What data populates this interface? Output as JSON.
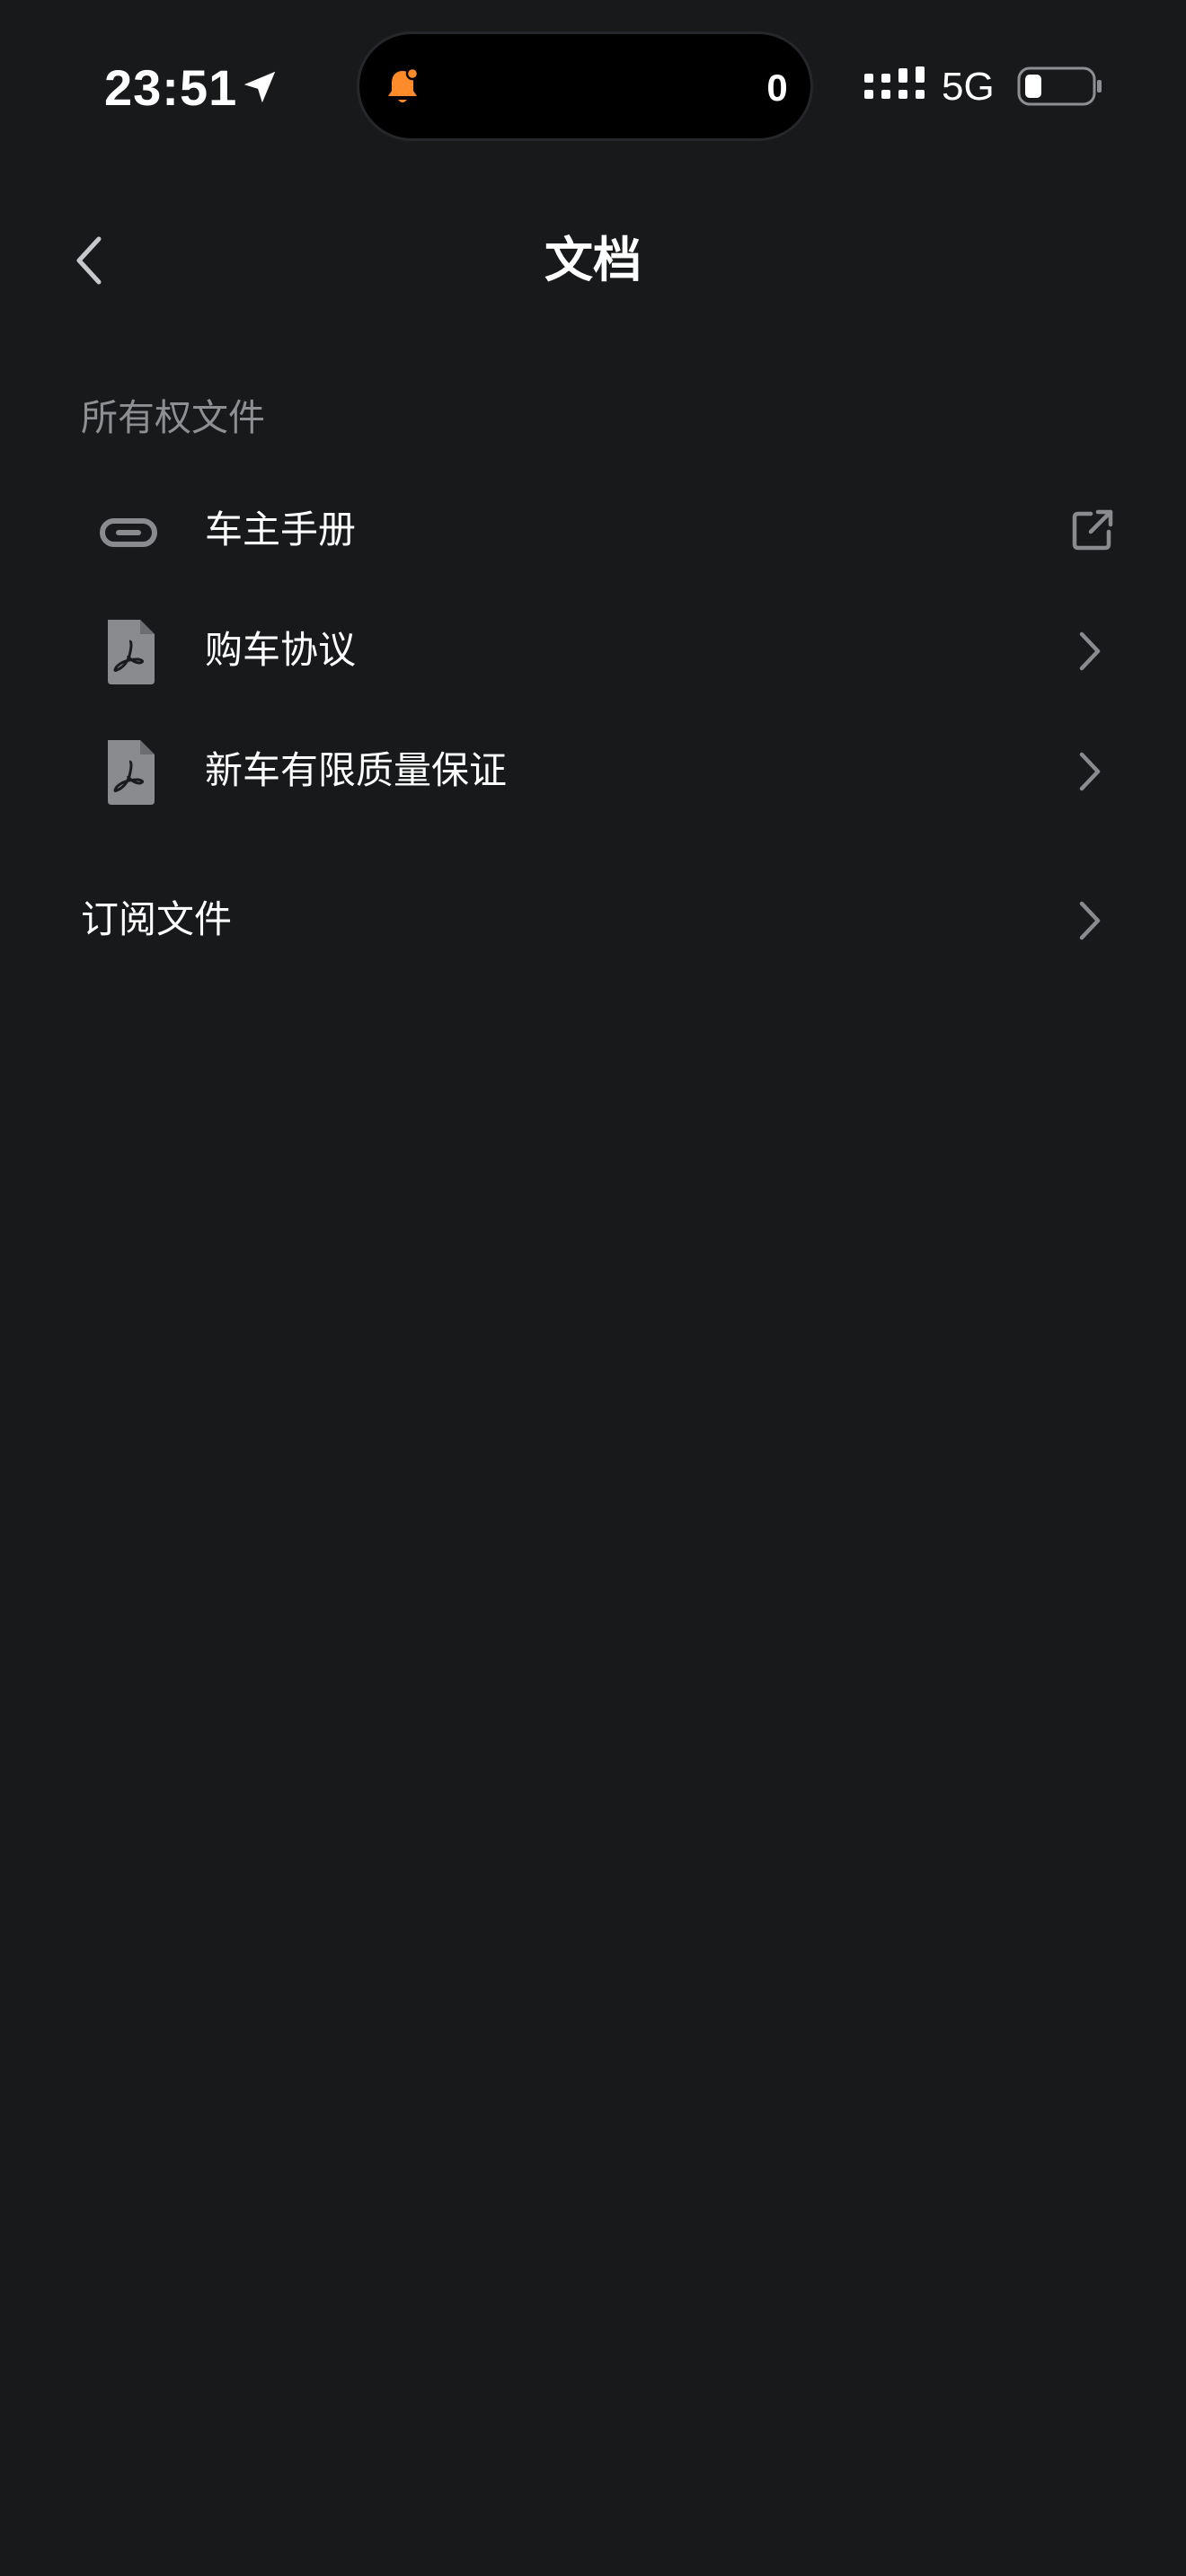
{
  "status_bar": {
    "time": "23:51",
    "island_count": "0",
    "network": "5G",
    "icons": [
      "location-arrow-icon",
      "bell-icon",
      "signal-icon",
      "battery-icon"
    ],
    "bell_color": "#ff8a2a"
  },
  "header": {
    "back_icon": "chevron-left-icon",
    "title": "文档"
  },
  "ownership_section": {
    "title": "所有权文件",
    "items": [
      {
        "label": "车主手册",
        "icon": "link-icon",
        "trailing": "external-link-icon"
      },
      {
        "label": "购车协议",
        "icon": "pdf-file-icon",
        "trailing": "chevron-right-icon"
      },
      {
        "label": "新车有限质量保证",
        "icon": "pdf-file-icon",
        "trailing": "chevron-right-icon"
      }
    ]
  },
  "subscription": {
    "label": "订阅文件",
    "trailing": "chevron-right-icon"
  },
  "colors": {
    "background": "#18191b",
    "text_primary": "#ffffff",
    "text_secondary": "#8e8f93",
    "icon_gray": "#8a8b8f"
  }
}
